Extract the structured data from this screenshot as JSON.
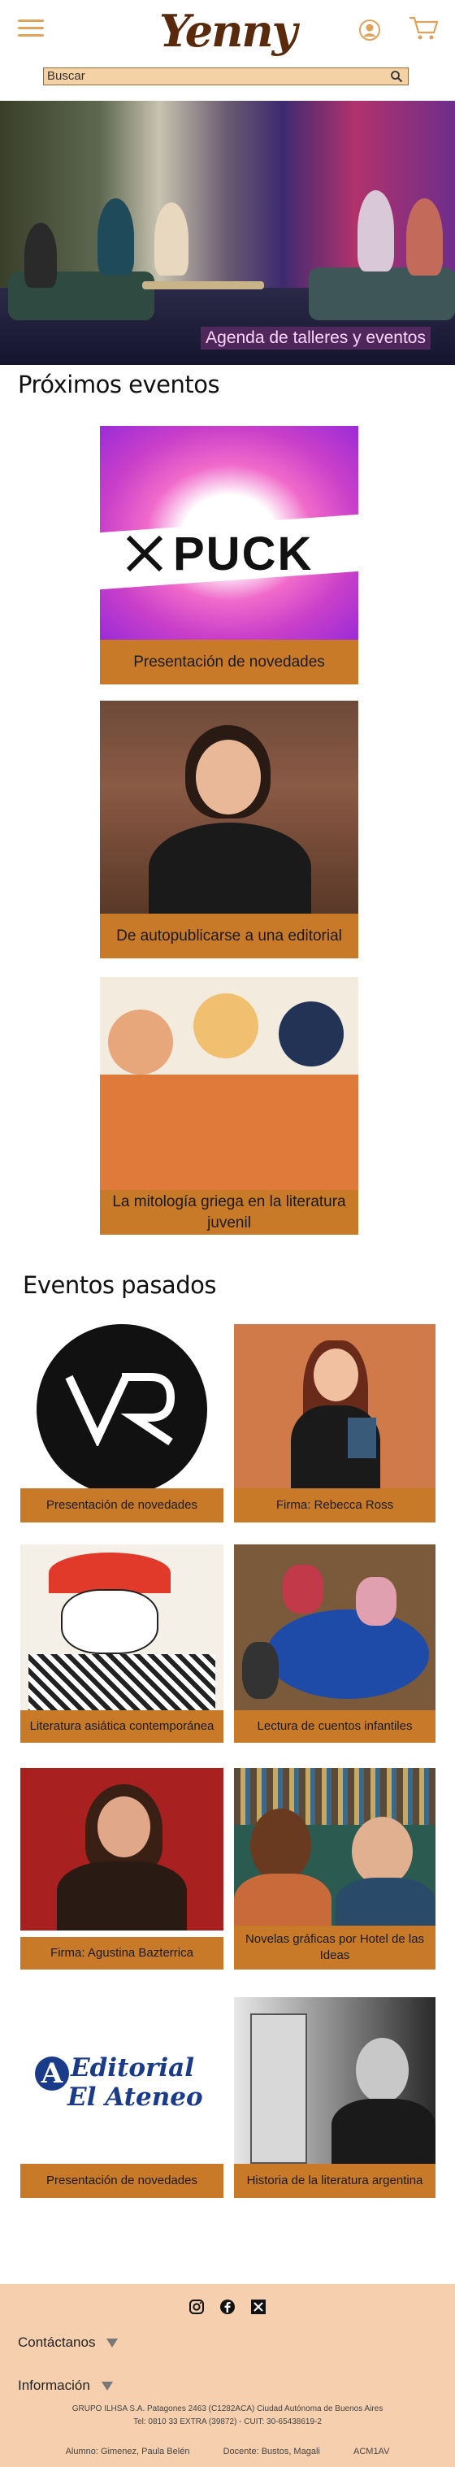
{
  "header": {
    "logo": "Yenny",
    "search": {
      "placeholder": "Buscar"
    }
  },
  "hero": {
    "caption": "Agenda de talleres y eventos"
  },
  "upcoming": {
    "title": "Próximos eventos",
    "events": [
      {
        "label": "Presentación de novedades",
        "image_text": "PUCK"
      },
      {
        "label": "De autopublicarse a una editorial"
      },
      {
        "label": "La mitología griega en la literatura juvenil"
      }
    ]
  },
  "past": {
    "title": "Eventos pasados",
    "events": [
      {
        "label": "Presentación de novedades"
      },
      {
        "label": "Firma: Rebecca Ross"
      },
      {
        "label": "Literatura asiática contemporánea"
      },
      {
        "label": "Lectura de cuentos infantiles"
      },
      {
        "label": "Firma: Agustina Bazterrica"
      },
      {
        "label": "Novelas gráficas por Hotel de las Ideas"
      },
      {
        "label": "Presentación de novedades",
        "image_text_1": "Editorial",
        "image_text_2": "El Ateneo"
      },
      {
        "label": "Historia de la literatura argentina"
      }
    ]
  },
  "footer": {
    "contact": "Contáctanos",
    "info": "Información",
    "legal_1": "GRUPO ILHSA S.A. Patagones 2463 (C1282ACA) Ciudad Autónoma de Buenos Aires",
    "legal_2": "Tel: 0810 33 EXTRA (39872) - CUIT: 30-65438619-2",
    "student": "Alumno: Gimenez, Paula Belén",
    "teacher": "Docente: Bustos, Magali",
    "course": "ACM1AV"
  },
  "colors": {
    "accent": "#c87a28",
    "footer_bg": "#f6d0ae",
    "search_bg": "#f5d2a6",
    "brand": "#5a2a0c"
  }
}
